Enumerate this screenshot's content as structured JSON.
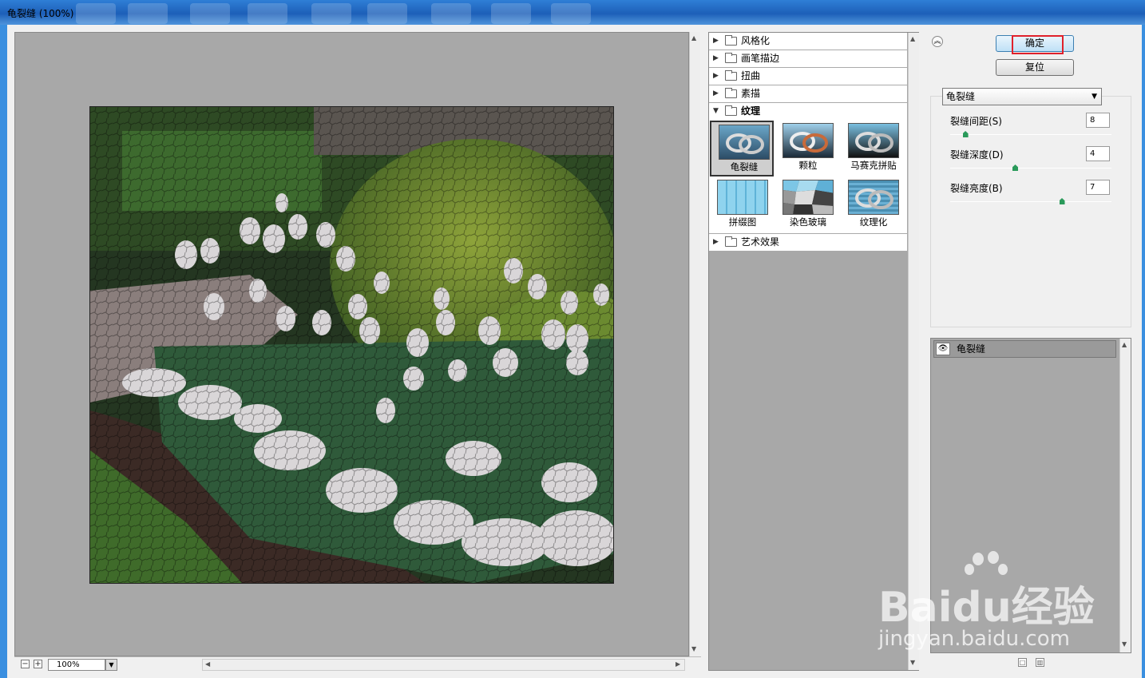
{
  "window": {
    "title": "龟裂缝 (100%)"
  },
  "preview": {
    "zoom": "100%"
  },
  "categories": [
    {
      "label": "风格化",
      "expanded": false
    },
    {
      "label": "画笔描边",
      "expanded": false
    },
    {
      "label": "扭曲",
      "expanded": false
    },
    {
      "label": "素描",
      "expanded": false
    },
    {
      "label": "纹理",
      "expanded": true
    },
    {
      "label": "艺术效果",
      "expanded": false
    }
  ],
  "texture_filters": [
    {
      "label": "龟裂缝",
      "selected": true
    },
    {
      "label": "颗粒",
      "selected": false
    },
    {
      "label": "马赛克拼贴",
      "selected": false
    },
    {
      "label": "拼缀图",
      "selected": false
    },
    {
      "label": "染色玻璃",
      "selected": false
    },
    {
      "label": "纹理化",
      "selected": false
    }
  ],
  "buttons": {
    "ok": "确定",
    "reset": "复位"
  },
  "filter_select": {
    "value": "龟裂缝"
  },
  "params": [
    {
      "label": "裂缝间距(S)",
      "value": "8",
      "max": 100
    },
    {
      "label": "裂缝深度(D)",
      "value": "4",
      "max": 10
    },
    {
      "label": "裂缝亮度(B)",
      "value": "7",
      "max": 10
    }
  ],
  "layers": [
    {
      "name": "龟裂缝"
    }
  ],
  "watermark": {
    "brand": "Baidu经验",
    "url": "jingyan.baidu.com"
  },
  "colors": {
    "highlight": "#e0212b",
    "primary_button": "#bfe0f6",
    "preview_bg": "#a8a8a8"
  }
}
